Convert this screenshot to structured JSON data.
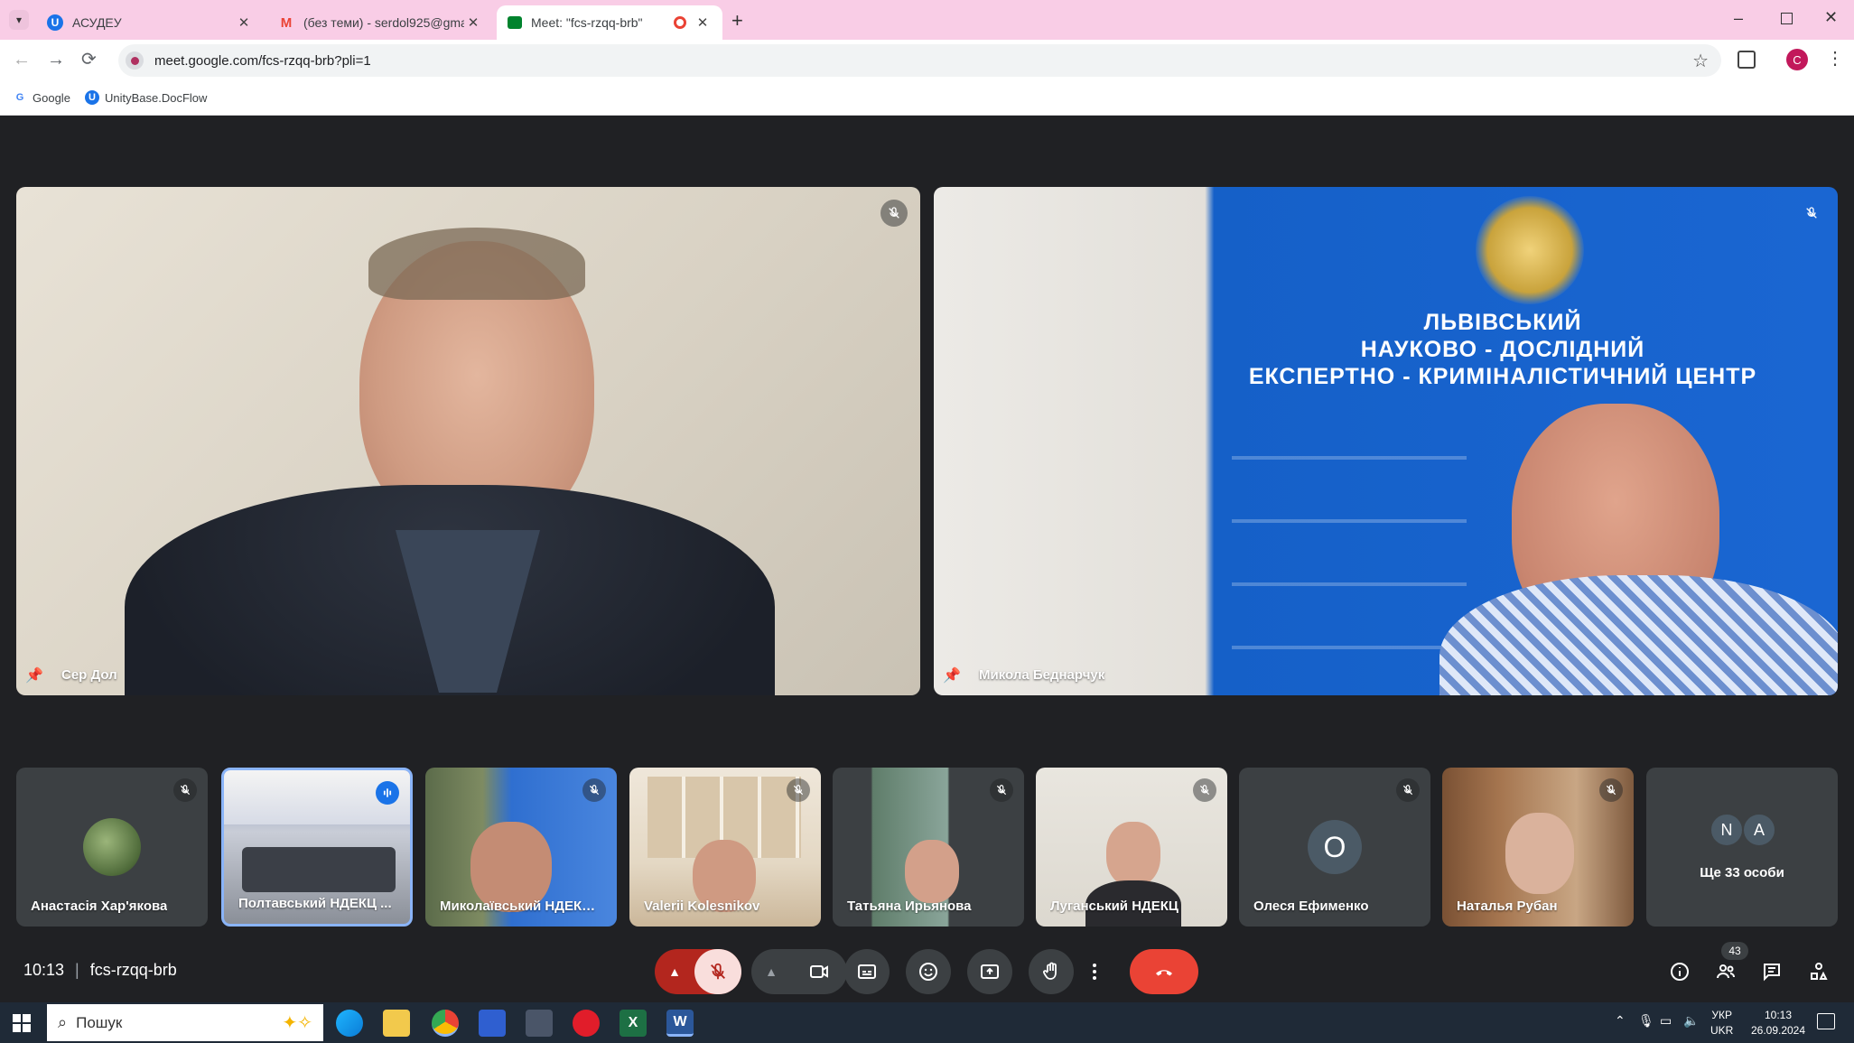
{
  "browser": {
    "tabs": [
      {
        "title": "АСУДЕУ",
        "active": false
      },
      {
        "title": "(без теми) - serdol925@gmail.c",
        "active": false
      },
      {
        "title": "Meet: \"fcs-rzqq-brb\"",
        "active": true
      }
    ],
    "url": "meet.google.com/fcs-rzqq-brb?pli=1",
    "bookmarks": [
      "Google",
      "UnityBase.DocFlow"
    ],
    "profile_initial": "C"
  },
  "meet": {
    "main_tiles": [
      {
        "name": "Сер Дол"
      },
      {
        "name": "Микола Беднарчук"
      }
    ],
    "banner_text": [
      "ЛЬВІВСЬКИЙ",
      "НАУКОВО - ДОСЛІДНИЙ",
      "ЕКСПЕРТНО - КРИМІНАЛІСТИЧНИЙ ЦЕНТР"
    ],
    "participants": [
      {
        "name": "Анастасія Хар'якова"
      },
      {
        "name": "Полтавський НДЕКЦ ..."
      },
      {
        "name": "Миколаївський НДЕКЦ..."
      },
      {
        "name": "Valerii Kolesnikov"
      },
      {
        "name": "Татьяна Ирьянова"
      },
      {
        "name": "Луганський НДЕКЦ"
      },
      {
        "name": "Олеся Ефименко",
        "initial": "О"
      },
      {
        "name": "Наталья Рубан"
      }
    ],
    "more": {
      "initials": [
        "N",
        "A"
      ],
      "label": "Ще 33 особи"
    },
    "time": "10:13",
    "separator": "|",
    "meeting_code": "fcs-rzqq-brb",
    "people_count": "43"
  },
  "taskbar": {
    "search_placeholder": "Пошук",
    "lang_top": "УКР",
    "lang_bottom": "UKR",
    "clock_time": "10:13",
    "clock_date": "26.09.2024"
  },
  "colors": {
    "tab_bar": "#f9cde6",
    "meet_bg": "#202124",
    "end_call": "#ea4335",
    "active_speaker": "#8ab4f8"
  }
}
